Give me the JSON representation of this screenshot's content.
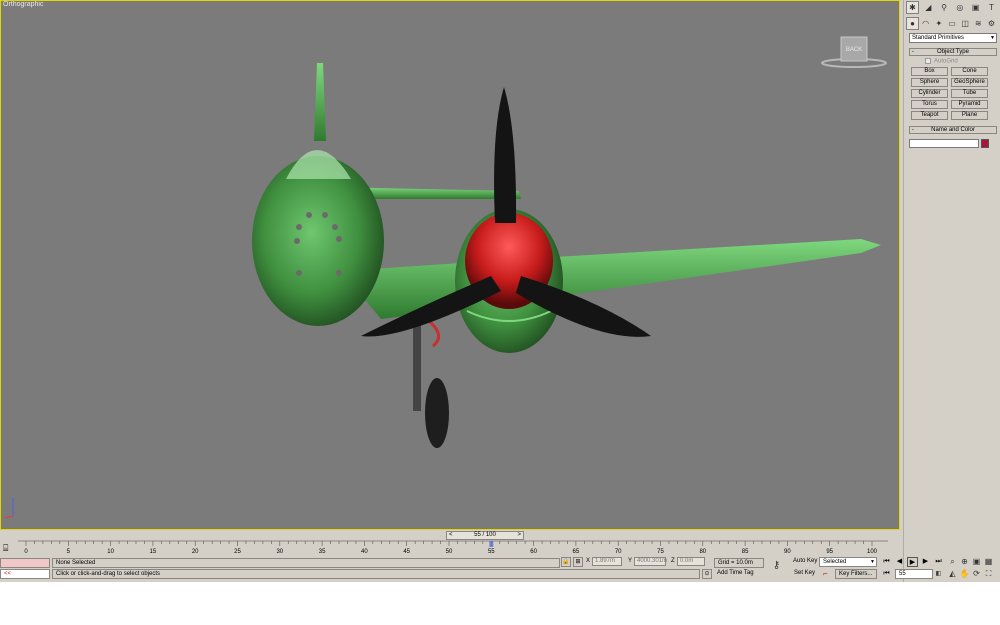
{
  "viewport": {
    "label": "Orthographic",
    "viewcube_label": "BACK"
  },
  "command_panel": {
    "tab_icons": [
      "create-icon",
      "modify-icon",
      "hierarchy-icon",
      "motion-icon",
      "display-icon",
      "utilities-icon"
    ],
    "category_icons": [
      "geometry-icon",
      "shapes-icon",
      "lights-icon",
      "cameras-icon",
      "helpers-icon",
      "spacewarps-icon",
      "systems-icon"
    ],
    "primitives_dropdown": "Standard Primitives",
    "object_type": {
      "title": "Object Type",
      "autogrid": "AutoGrid",
      "buttons": [
        "Box",
        "Cone",
        "Sphere",
        "GeoSphere",
        "Cylinder",
        "Tube",
        "Torus",
        "Pyramid",
        "Teapot",
        "Plane"
      ]
    },
    "name_and_color": {
      "title": "Name and Color",
      "name_value": "",
      "color": "#a8143a"
    }
  },
  "timeline": {
    "slider_label": "55 / 100",
    "prev": "<",
    "next": ">",
    "ticks": [
      "0",
      "5",
      "10",
      "15",
      "20",
      "25",
      "30",
      "35",
      "40",
      "45",
      "50",
      "55",
      "60",
      "65",
      "70",
      "75",
      "80",
      "85",
      "90",
      "95",
      "100"
    ],
    "current_frame": 55
  },
  "status": {
    "maxscript_button": "<<",
    "selection": "None Selected",
    "prompt": "Click or click-and-drag to select objects",
    "x_label": "X",
    "x_value": "1.897m",
    "y_label": "Y",
    "y_value": "4000.301m",
    "z_label": "Z",
    "z_value": "0.0m",
    "grid": "Grid = 10.0m",
    "add_time_tag": "Add Time Tag",
    "auto_key": "Auto Key",
    "set_key": "Set Key",
    "key_mode": "Selected",
    "key_filters": "Key Filters...",
    "frame_field": "55"
  }
}
